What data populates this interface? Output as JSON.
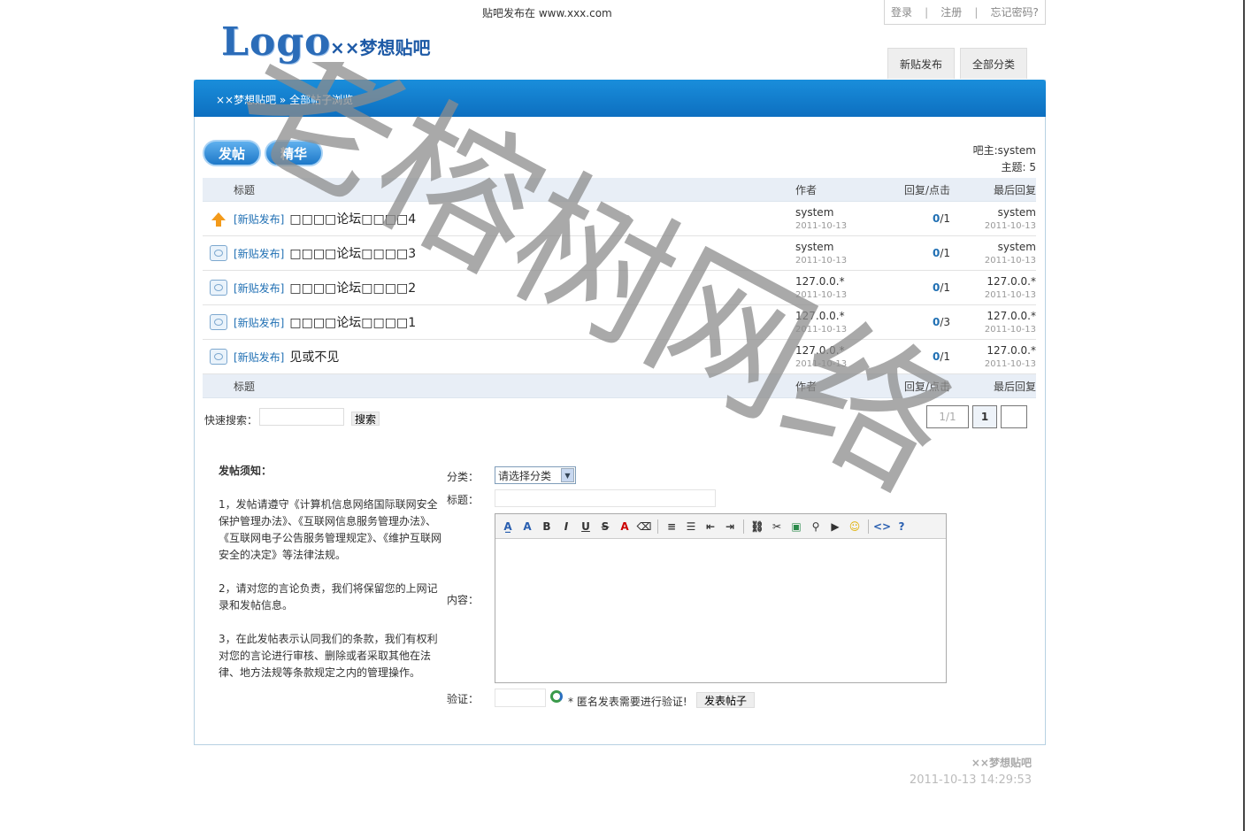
{
  "header": {
    "site_url": "贴吧发布在  www.xxx.com",
    "logo": "Logo",
    "site_name": "××梦想贴吧",
    "top_links": {
      "login": "登录",
      "register": "注册",
      "forgot": "忘记密码?"
    },
    "tabs": {
      "new_post": "新贴发布",
      "all_categories": "全部分类"
    }
  },
  "breadcrumb": "××梦想贴吧 » 全部帖子浏览",
  "actions": {
    "post": "发帖",
    "elite": "精华"
  },
  "forum_info": {
    "owner": "吧主:system",
    "topics": "主题: 5"
  },
  "table": {
    "headers": {
      "title": "标题",
      "author": "作者",
      "reply_click": "回复/点击",
      "last_reply": "最后回复"
    },
    "rows": [
      {
        "icon": "pinned-up-arrow-icon",
        "category": "[新贴发布]",
        "title": "□□□□论坛□□□□4",
        "author": "system",
        "date": "2011-10-13",
        "replies": "0",
        "clicks": "/1",
        "last_user": "system",
        "last_date": "2011-10-13"
      },
      {
        "icon": "thread-icon",
        "category": "[新贴发布]",
        "title": "□□□□论坛□□□□3",
        "author": "system",
        "date": "2011-10-13",
        "replies": "0",
        "clicks": "/1",
        "last_user": "system",
        "last_date": "2011-10-13"
      },
      {
        "icon": "thread-icon",
        "category": "[新贴发布]",
        "title": "□□□□论坛□□□□2",
        "author": "127.0.0.*",
        "date": "2011-10-13",
        "replies": "0",
        "clicks": "/1",
        "last_user": "127.0.0.*",
        "last_date": "2011-10-13"
      },
      {
        "icon": "thread-icon",
        "category": "[新贴发布]",
        "title": "□□□□论坛□□□□1",
        "author": "127.0.0.*",
        "date": "2011-10-13",
        "replies": "0",
        "clicks": "/3",
        "last_user": "127.0.0.*",
        "last_date": "2011-10-13"
      },
      {
        "icon": "thread-icon",
        "category": "[新贴发布]",
        "title": "见或不见",
        "author": "127.0.0.*",
        "date": "2011-10-13",
        "replies": "0",
        "clicks": "/1",
        "last_user": "127.0.0.*",
        "last_date": "2011-10-13"
      }
    ]
  },
  "search": {
    "label": "快速搜索：",
    "button": "搜索"
  },
  "pager": {
    "info": "1/1",
    "current": "1",
    "next": ""
  },
  "notice": {
    "heading": "发帖须知：",
    "items": [
      "1，发帖请遵守《计算机信息网络国际联网安全保护管理办法》、《互联网信息服务管理办法》、 《互联网电子公告服务管理规定》、《维护互联网安全的决定》等法律法规。",
      "2，请对您的言论负责，我们将保留您的上网记录和发帖信息。",
      "3，在此发帖表示认同我们的条款，我们有权利对您的言论进行审核、删除或者采取其他在法律、地方法规等条款规定之内的管理操作。"
    ]
  },
  "form": {
    "category_label": "分类：",
    "category_value": "请选择分类",
    "title_label": "标题：",
    "content_label": "内容：",
    "verify_label": "验证：",
    "verify_note": "* 匿名发表需要进行验证!",
    "submit": "发表帖子"
  },
  "footer": {
    "name": "××梦想贴吧",
    "time": "2011-10-13 14:29:53"
  },
  "watermark": "老榕树网络",
  "colors": {
    "bar": "#0d6fc0",
    "link": "#1f6fb3",
    "pill": "#1d78c8"
  }
}
